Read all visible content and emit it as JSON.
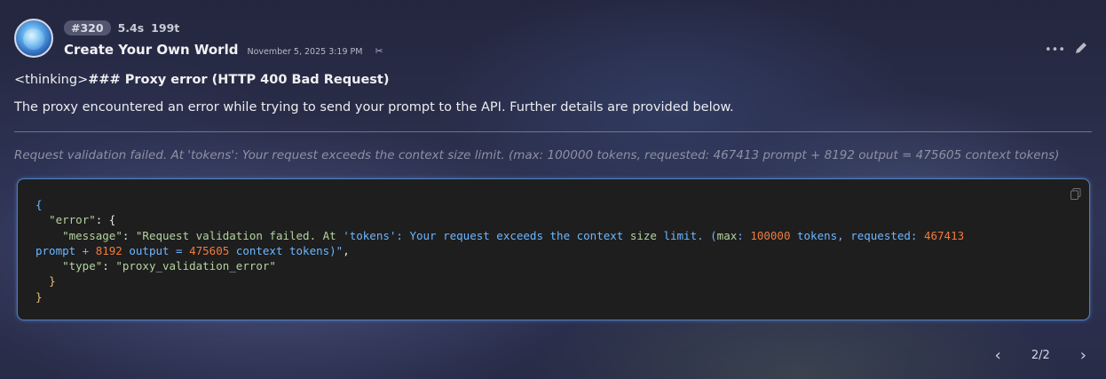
{
  "message": {
    "id_badge": "#320",
    "duration": "5.4s",
    "tokens": "199t",
    "author": "Create Your Own World",
    "timestamp": "November 5, 2025 3:19 PM",
    "heading_prefix": "<thinking>",
    "heading_bold": "### Proxy error (HTTP 400 Bad Request)",
    "paragraph": "The proxy encountered an error while trying to send your prompt to the API. Further details are provided below.",
    "note": "Request validation failed. At 'tokens': Your request exceeds the context size limit. (max: 100000 tokens, requested: 467413 prompt + 8192 output = 475605 context tokens)"
  },
  "code": {
    "open": "{",
    "error_key": "\"error\"",
    "error_colon": ": {",
    "message_key": "\"message\"",
    "message_colon": ": ",
    "msg_part1": "\"Request validation failed. At ",
    "msg_part2": "'tokens'",
    "msg_part3": ": Your request exceeds the context ",
    "msg_size": "size",
    "msg_part4": " limit. (",
    "msg_max": "max",
    "msg_part5": ": ",
    "msg_100000": "100000",
    "msg_part6": " tokens, requested: ",
    "msg_467413": "467413",
    "line2_prompt": "prompt + ",
    "line2_8192": "8192",
    "line2_output": " output = ",
    "line2_475605": "475605",
    "line2_rest": " context tokens)\"",
    "line2_comma": ",",
    "type_key": "\"type\"",
    "type_colon": ": ",
    "type_value": "\"proxy_validation_error\"",
    "inner_close": "}",
    "outer_close": "}"
  },
  "pager": {
    "label": "2/2"
  },
  "icons": {
    "copy": "copy-icon",
    "more": "more-icon",
    "edit": "pencil-icon",
    "pin": "pin-icon",
    "prev": "chevron-left-icon",
    "next": "chevron-right-icon"
  }
}
